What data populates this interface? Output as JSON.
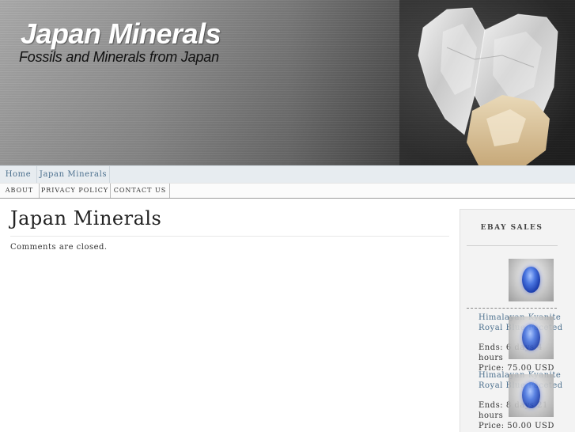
{
  "header": {
    "title": "Japan Minerals",
    "tagline": "Fossils and Minerals from Japan"
  },
  "nav_primary": [
    {
      "label": "Home"
    },
    {
      "label": "Japan Minerals"
    }
  ],
  "nav_secondary": [
    {
      "label": "ABOUT"
    },
    {
      "label": "PRIVACY POLICY"
    },
    {
      "label": "CONTACT US"
    }
  ],
  "main": {
    "title": "Japan Minerals",
    "comments_note": "Comments are closed."
  },
  "sidebar": {
    "heading": "EBAY SALES",
    "listings": [
      {
        "title": "Himalayan Kyanite Royal Blue Faceted",
        "ends": "Ends: 6 days 4 hours",
        "price": "Price: 75.00 USD"
      },
      {
        "title": "Himalayan Kyanite Royal Blue Faceted",
        "ends": "Ends: 8 days 21 hours",
        "price": "Price: 50.00 USD"
      }
    ]
  },
  "colors": {
    "link": "#4b6f8d",
    "nav_bg": "#e7ecf0",
    "sidebar_bg": "#f3f3f3"
  }
}
